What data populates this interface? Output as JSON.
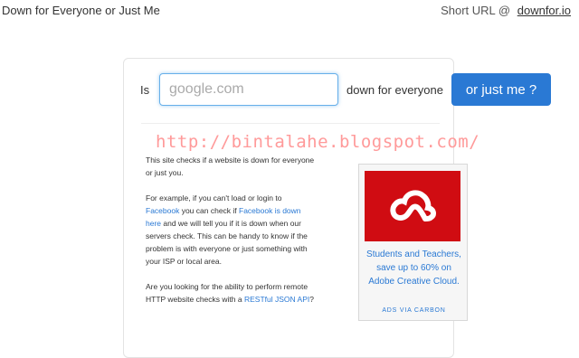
{
  "header": {
    "site_title": "Down for Everyone or Just Me",
    "short_url_label": "Short URL @",
    "short_url_link": "downfor.io"
  },
  "form": {
    "prefix": "Is",
    "input_placeholder": "google.com",
    "input_value": "",
    "suffix": "down for everyone",
    "button_label": "or just me ?"
  },
  "watermark": "http://bintalahe.blogspot.com/",
  "description": {
    "p1": "This site checks if a website is down for everyone or just you.",
    "p2_intro": "For example, if you can't load or login to ",
    "p2_link1": "Facebook",
    "p2_mid": " you can check if ",
    "p2_link2": "Facebook is down here",
    "p2_outro": " and we will tell you if it is down when our servers check. This can be handy to know if the problem is with everyone or just something with your ISP or local area.",
    "p3_intro": "Are you looking for the ability to perform remote HTTP website checks with a ",
    "p3_link": "RESTful JSON API",
    "p3_outro": "?"
  },
  "ad": {
    "text": "Students and Teachers, save up to 60% on Adobe Creative Cloud.",
    "credit": "ADS VIA CARBON",
    "icon": "adobe-creative-cloud-logo",
    "background_color": "#d00c12"
  },
  "colors": {
    "accent": "#2a79d4",
    "watermark": "#ff9a9a"
  }
}
